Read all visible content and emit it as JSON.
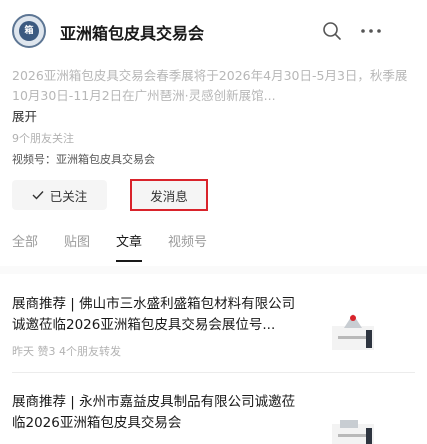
{
  "header": {
    "account_name": "亚洲箱包皮具交易会",
    "logo_text": "箱"
  },
  "profile": {
    "intro": "2026亚洲箱包皮具交易会春季展将于2026年4月30日-5月3日，秋季展10月30日-11月2日在广州琶洲·灵感创新展馆...",
    "expand_label": "展开",
    "friends_following": "9个朋友关注",
    "channel_label": "视频号：亚洲箱包皮具交易会"
  },
  "actions": {
    "follow_label": "已关注",
    "message_label": "发消息",
    "highlight_color": "#d9232b"
  },
  "tabs": [
    {
      "label": "全部",
      "active": false
    },
    {
      "label": "贴图",
      "active": false
    },
    {
      "label": "文章",
      "active": true
    },
    {
      "label": "视频号",
      "active": false
    }
  ],
  "articles": [
    {
      "title": "展商推荐 | 佛山市三水盛利盛箱包材料有限公司 诚邀莅临2026亚洲箱包皮具交易会展位号...",
      "meta": "昨天  赞3  4个朋友转发"
    },
    {
      "title": "展商推荐 | 永州市嘉益皮具制品有限公司诚邀莅临2026亚洲箱包皮具交易会",
      "meta": ""
    }
  ]
}
